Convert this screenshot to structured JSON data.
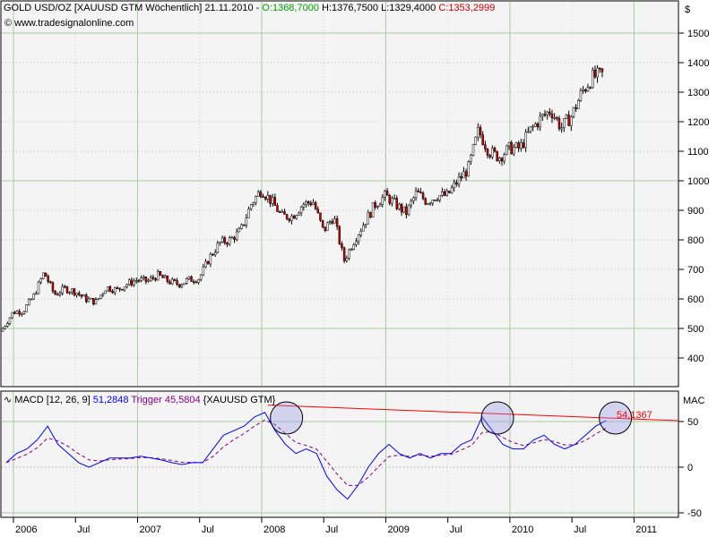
{
  "header": {
    "symbol": "GOLD USD/OZ [XAUUSD GTM  Wöchentlich] 21.11.2010 - ",
    "open": "O:1368,7000",
    "rest": " H:1376,7500 L:1329,4000 ",
    "close": "C:1353,2999",
    "source": "www.tradesignalonline.com",
    "currency": "$"
  },
  "macd_header": {
    "name": "MACD [12, 26, 9]",
    "value": "51,2848",
    "trigger": "Trigger 45,5804",
    "symbol": "{XAUUSD GTM}",
    "axis_title": "MAC",
    "trend_label": "54,1367"
  },
  "colors": {
    "up": "#000000",
    "down": "#cc0000",
    "macd": "#0000ff",
    "trigger": "#800080",
    "trend": "#ff0000",
    "grid": "#a8cca0"
  },
  "chart_data": [
    {
      "type": "candlestick",
      "title": "GOLD USD/OZ weekly",
      "ylim": [
        300,
        1550
      ],
      "yticks": [
        400,
        500,
        600,
        700,
        800,
        900,
        1000,
        1100,
        1200,
        1300,
        1400,
        1500
      ],
      "xticks": [
        "2006",
        "Jul",
        "2007",
        "Jul",
        "2008",
        "Jul",
        "2009",
        "Jul",
        "2010",
        "Jul",
        "2011"
      ],
      "monthly_close_from_2006_01": [
        500,
        555,
        560,
        610,
        690,
        615,
        635,
        625,
        600,
        590,
        640,
        630,
        650,
        665,
        660,
        680,
        660,
        650,
        665,
        670,
        740,
        790,
        800,
        830,
        920,
        970,
        930,
        880,
        880,
        920,
        930,
        830,
        880,
        730,
        800,
        860,
        920,
        950,
        920,
        890,
        960,
        930,
        950,
        950,
        1000,
        1040,
        1170,
        1100,
        1080,
        1110,
        1110,
        1170,
        1210,
        1240,
        1180,
        1220,
        1300,
        1350,
        1360
      ]
    },
    {
      "type": "line",
      "title": "MACD [12, 26, 9]",
      "ylim": [
        -55,
        80
      ],
      "yticks": [
        50,
        0,
        -50
      ],
      "macd_monthly_from_2006_01": [
        5,
        15,
        20,
        30,
        45,
        25,
        15,
        5,
        0,
        5,
        10,
        10,
        10,
        12,
        10,
        8,
        5,
        3,
        5,
        5,
        20,
        35,
        40,
        45,
        55,
        60,
        40,
        25,
        15,
        20,
        15,
        -10,
        -25,
        -35,
        -20,
        0,
        15,
        25,
        15,
        10,
        15,
        10,
        15,
        15,
        25,
        30,
        55,
        40,
        25,
        20,
        20,
        30,
        35,
        25,
        20,
        25,
        35,
        45,
        51
      ],
      "trendline": [
        [
          2008.05,
          68
        ],
        [
          2011.4,
          51
        ]
      ],
      "highlight_circles_at": [
        2008.2,
        2009.9,
        2010.85
      ]
    }
  ]
}
